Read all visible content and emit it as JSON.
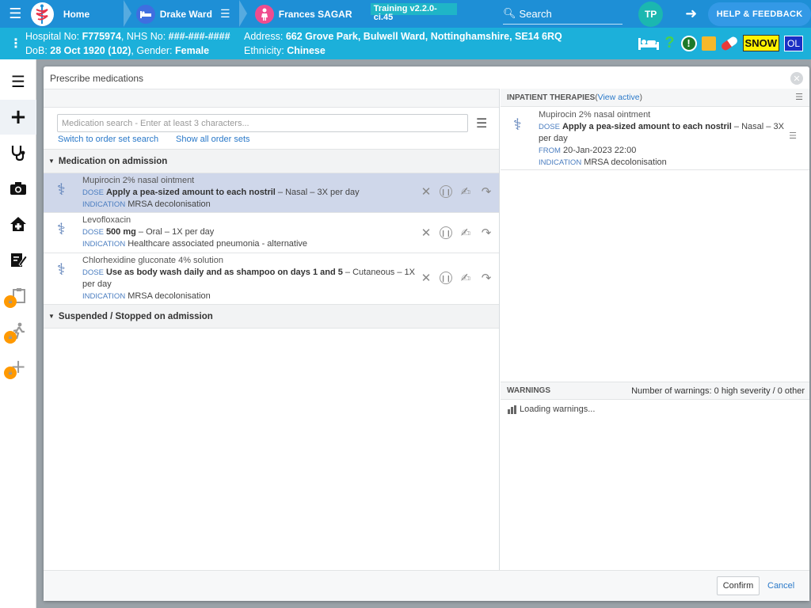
{
  "topbar": {
    "home_label": "Home",
    "ward_label": "Drake Ward",
    "patient_label": "Frances SAGAR",
    "training_label": "Training v2.2.0-ci.45",
    "search_label": "Search",
    "avatar_initials": "TP",
    "help_label": "HELP & FEEDBACK"
  },
  "banner": {
    "hospital_prefix": "Hospital No: ",
    "hospital_no": "F775974",
    "nhs_prefix": ", NHS No: ",
    "nhs_no": "###-###-####",
    "dob_prefix": "DoB: ",
    "dob": "28 Oct 1920 (102)",
    "gender_prefix": ", Gender: ",
    "gender": "Female",
    "address_prefix": "Address: ",
    "address": "662 Grove Park, Bulwell Ward, Nottinghamshire, SE14 6RQ",
    "ethnicity_prefix": "Ethnicity: ",
    "ethnicity": "Chinese",
    "snow_label": "SNOW",
    "ol_label": "OL",
    "q_label": "?",
    "alert_label": "!"
  },
  "modal": {
    "title": "Prescribe medications",
    "search_placeholder": "Medication search - Enter at least 3 characters...",
    "link_order_set": "Switch to order set search",
    "link_all_sets": "Show all order sets",
    "section_admission": "Medication on admission",
    "section_suspended": "Suspended / Stopped on admission",
    "dose_tag": "DOSE",
    "indication_tag": "INDICATION",
    "from_tag": "FROM",
    "medications": [
      {
        "name": "Mupirocin 2% nasal ointment",
        "dose": "Apply a pea-sized amount to each nostril",
        "route": " – Nasal – 3X per day",
        "indication": "MRSA decolonisation"
      },
      {
        "name": "Levofloxacin",
        "dose": "500 mg",
        "route": " – Oral – 1X per day",
        "indication": "Healthcare associated pneumonia - alternative"
      },
      {
        "name": "Chlorhexidine gluconate 4% solution",
        "dose": "Use as body wash daily and as shampoo on days 1 and 5",
        "route": " – Cutaneous – 1X per day",
        "indication": "MRSA decolonisation"
      }
    ],
    "inpatient": {
      "title": "INPATIENT THERAPIES",
      "open_paren": " (",
      "view_active": "View active",
      "close_paren": ")",
      "name": "Mupirocin 2% nasal ointment",
      "dose": "Apply a pea-sized amount to each nostril",
      "route": " – Nasal – 3X per day",
      "from": "20-Jan-2023 22:00",
      "indication": "MRSA decolonisation"
    },
    "warnings": {
      "title": "WARNINGS",
      "count_text": "Number of warnings: 0 high severity / 0 other",
      "loading": "Loading warnings..."
    },
    "confirm_label": "Confirm",
    "cancel_label": "Cancel"
  }
}
